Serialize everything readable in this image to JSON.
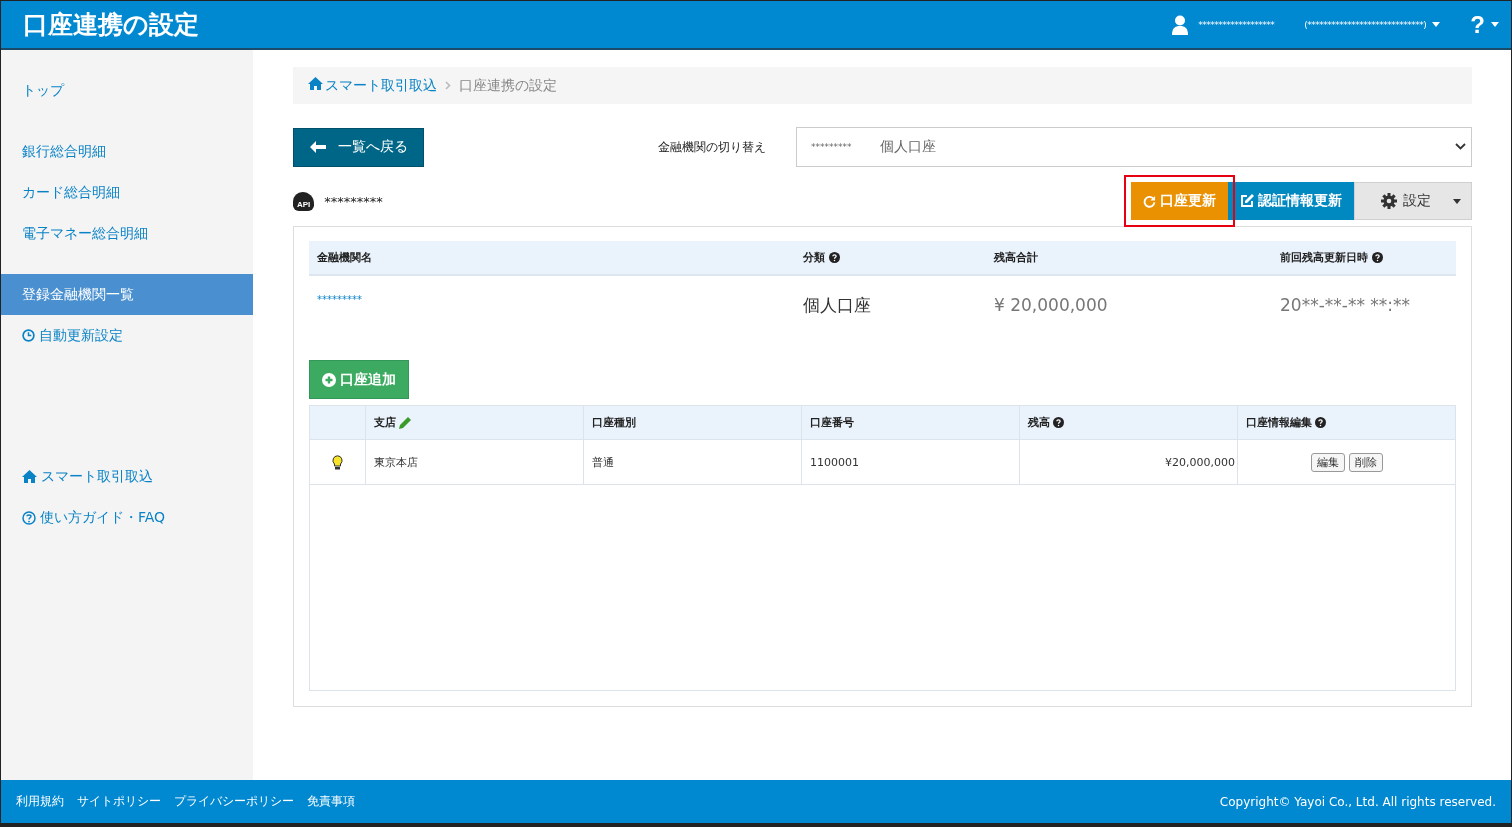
{
  "header": {
    "title": "口座連携の設定",
    "user": "*******************",
    "office": "(*****************************)",
    "help": "?"
  },
  "sidebar": {
    "groups": [
      [
        {
          "label": "トップ",
          "kind": "link",
          "selected": false
        }
      ],
      [
        {
          "label": "銀行総合明細",
          "kind": "link",
          "selected": false
        },
        {
          "label": "カード総合明細",
          "kind": "link",
          "selected": false
        },
        {
          "label": "電子マネー総合明細",
          "kind": "link",
          "selected": false
        }
      ],
      [
        {
          "label": "登録金融機関一覧",
          "kind": "link",
          "selected": true
        },
        {
          "label": "自動更新設定",
          "kind": "clock",
          "selected": false
        }
      ],
      [
        {
          "label": "スマート取引取込",
          "kind": "home",
          "selected": false
        },
        {
          "label": "使い方ガイド・FAQ",
          "kind": "help",
          "selected": false
        }
      ]
    ]
  },
  "breadcrumb": [
    {
      "label": "スマート取引取込",
      "home": true
    },
    {
      "label": "口座連携の設定",
      "home": false
    }
  ],
  "back_button": "一覧へ戻る",
  "switcher": {
    "label": "金融機関の切り替え",
    "value_code": "*********",
    "value_type": "個人口座"
  },
  "institution": {
    "badge": "API",
    "name": "*********"
  },
  "actions": [
    {
      "label": "口座更新",
      "kind": "refresh",
      "highlighted": true
    },
    {
      "label": "認証情報更新",
      "kind": "edit",
      "highlighted": false
    },
    {
      "label": "設定",
      "kind": "settings",
      "highlighted": false
    }
  ],
  "summary": {
    "columns": [
      {
        "label": "金融機関名",
        "help": false
      },
      {
        "label": "分類",
        "help": true
      },
      {
        "label": "残高合計",
        "help": false
      },
      {
        "label": "前回残高更新日時",
        "help": true
      }
    ],
    "row": {
      "name": "*********",
      "type": "個人口座",
      "total": "¥ 20,000,000",
      "updated": "20**-**-**  **:**"
    }
  },
  "add_button": "口座追加",
  "accounts": {
    "columns": [
      {
        "label": "支店",
        "help": false,
        "editable": true
      },
      {
        "label": "口座種別",
        "help": false,
        "editable": false
      },
      {
        "label": "口座番号",
        "help": false,
        "editable": false
      },
      {
        "label": "残高",
        "help": true,
        "editable": false
      },
      {
        "label": "口座情報編集",
        "help": true,
        "editable": false
      }
    ],
    "rows": [
      {
        "branch": "東京本店",
        "type": "普通",
        "number": "1100001",
        "balance": "¥20,000,000",
        "edit": "編集",
        "delete": "削除"
      }
    ]
  },
  "footer": {
    "links": [
      "利用規約",
      "サイトポリシー",
      "プライバシーポリシー",
      "免責事項"
    ],
    "copyright": "Copyright© Yayoi Co., Ltd. All rights reserved."
  }
}
